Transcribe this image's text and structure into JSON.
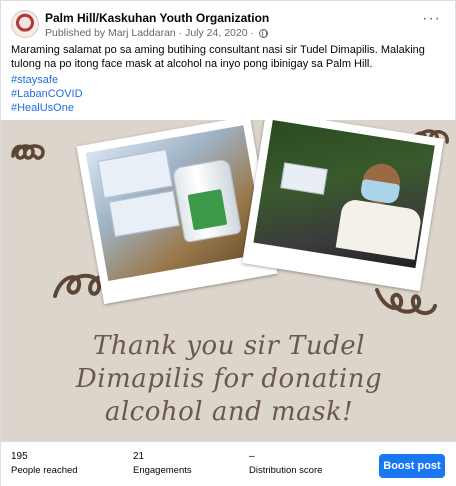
{
  "post": {
    "page_name": "Palm Hill/Kaskuhan Youth Organization",
    "published_by": "Published by Marj Laddaran",
    "date": "July 24, 2020",
    "separator": "·",
    "more_icon": "more-horizontal-icon",
    "privacy_icon": "globe-icon",
    "caption": "Maraming salamat po sa aming butihing consultant nasi sir Tudel Dimapilis. Malaking tulong na po itong face mask at alcohol na inyo pong ibinigay sa Palm Hill.",
    "hashtags": [
      "#staysafe",
      "#LabanCOVID",
      "#HealUsOne"
    ]
  },
  "image": {
    "text_line_1": "Thank you sir Tudel",
    "text_line_2": "Dimapilis for donating",
    "text_line_3": "alcohol and mask!"
  },
  "stats": {
    "reached_value": "195",
    "reached_label": "People reached",
    "engagements_value": "21",
    "engagements_label": "Engagements",
    "distribution_value": "–",
    "distribution_label": "Distribution score",
    "boost_label": "Boost post"
  },
  "colors": {
    "link": "#216fdb",
    "button": "#1877f2",
    "image_background": "#dcd5cb",
    "script_text": "#6b5a4a"
  }
}
